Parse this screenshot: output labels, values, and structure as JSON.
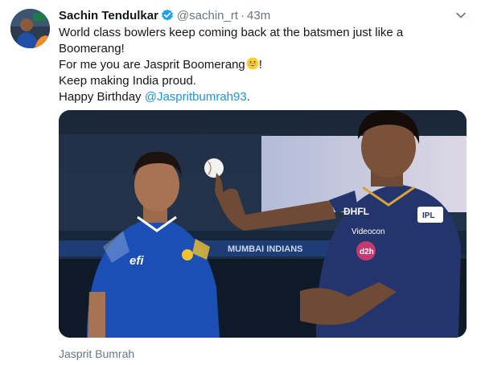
{
  "author": {
    "name": "Sachin Tendulkar",
    "handle": "@sachin_rt",
    "separator": "·",
    "time": "43m",
    "verified_icon": "verified-badge-icon"
  },
  "tweet": {
    "line1": "World class bowlers keep coming back at the batsmen just like a Boomerang!",
    "line2": "For me you are Jasprit Boomerang",
    "line2_emoji": "grinning-face-emoji",
    "line2_end": "!",
    "line3": "Keep making India proud.",
    "line4_prefix": "Happy Birthday ",
    "line4_mention": "@Jaspritbumrah93",
    "line4_suffix": "."
  },
  "media": {
    "banner_text": "MUMBAI INDIANS",
    "jersey_left_text": "efi",
    "jersey_right_text_1": "DHFL",
    "jersey_right_text_2": "Videocon",
    "jersey_right_text_3": "d2h",
    "jersey_right_badge": "IPL"
  },
  "caption": "Jasprit Bumrah",
  "colors": {
    "mention": "#1b95e0",
    "verified": "#1da1f2",
    "muted": "#657786"
  }
}
